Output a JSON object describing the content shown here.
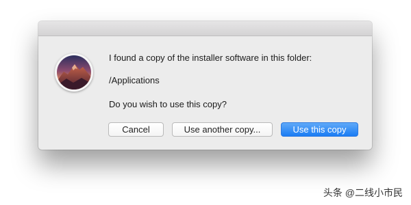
{
  "dialog": {
    "app_icon": "macos-sierra-installer-icon",
    "message_line_1": "I found a copy of the installer software in this folder:",
    "folder_path": "/Applications",
    "question": "Do you wish to use this copy?",
    "buttons": {
      "cancel": "Cancel",
      "use_another": "Use another copy...",
      "use_this": "Use this copy"
    }
  },
  "watermark": {
    "text": "头条 @二线小市民"
  },
  "colors": {
    "dialog_background": "#ececec",
    "primary_button": "#1a7cf4",
    "primary_button_text": "#ffffff"
  }
}
